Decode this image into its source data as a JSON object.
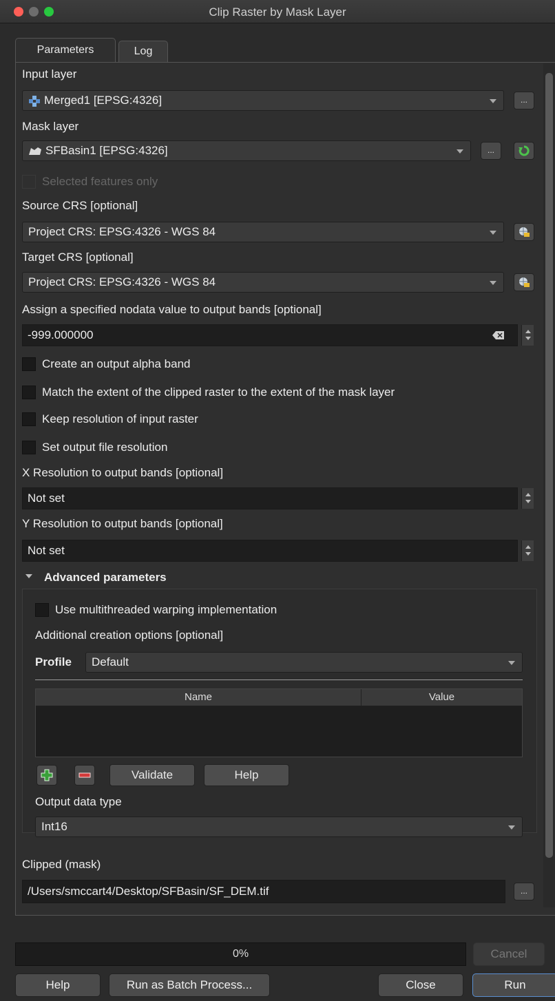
{
  "window": {
    "title": "Clip Raster by Mask Layer"
  },
  "tabs": [
    {
      "label": "Parameters"
    },
    {
      "label": "Log"
    }
  ],
  "input_layer": {
    "label": "Input layer",
    "value": "Merged1 [EPSG:4326]",
    "browse": "..."
  },
  "mask_layer": {
    "label": "Mask layer",
    "value": "SFBasin1 [EPSG:4326]",
    "browse": "..."
  },
  "selected_only": {
    "label": "Selected features only"
  },
  "source_crs": {
    "label": "Source CRS [optional]",
    "value": "Project CRS: EPSG:4326 - WGS 84"
  },
  "target_crs": {
    "label": "Target CRS [optional]",
    "value": "Project CRS: EPSG:4326 - WGS 84"
  },
  "nodata": {
    "label": "Assign a specified nodata value to output bands [optional]",
    "value": "-999.000000"
  },
  "checks": {
    "alpha": "Create an output alpha band",
    "match_extent": "Match the extent of the clipped raster to the extent of the mask layer",
    "keep_res": "Keep resolution of input raster",
    "set_res": "Set output file resolution"
  },
  "x_res": {
    "label": "X Resolution to output bands [optional]",
    "value": "Not set"
  },
  "y_res": {
    "label": "Y Resolution to output bands [optional]",
    "value": "Not set"
  },
  "advanced": {
    "title": "Advanced parameters",
    "multithread": "Use multithreaded warping implementation",
    "creation_label": "Additional creation options [optional]",
    "profile_label": "Profile",
    "profile_value": "Default",
    "col_name": "Name",
    "col_value": "Value",
    "validate": "Validate",
    "help": "Help",
    "data_type_label": "Output data type",
    "data_type_value": "Int16"
  },
  "output": {
    "label": "Clipped (mask)",
    "value": "/Users/smccart4/Desktop/SFBasin/SF_DEM.tif",
    "browse": "..."
  },
  "progress": {
    "text": "0%",
    "fraction": 0
  },
  "footer": {
    "cancel": "Cancel",
    "help": "Help",
    "batch": "Run as Batch Process...",
    "close": "Close",
    "run": "Run"
  }
}
